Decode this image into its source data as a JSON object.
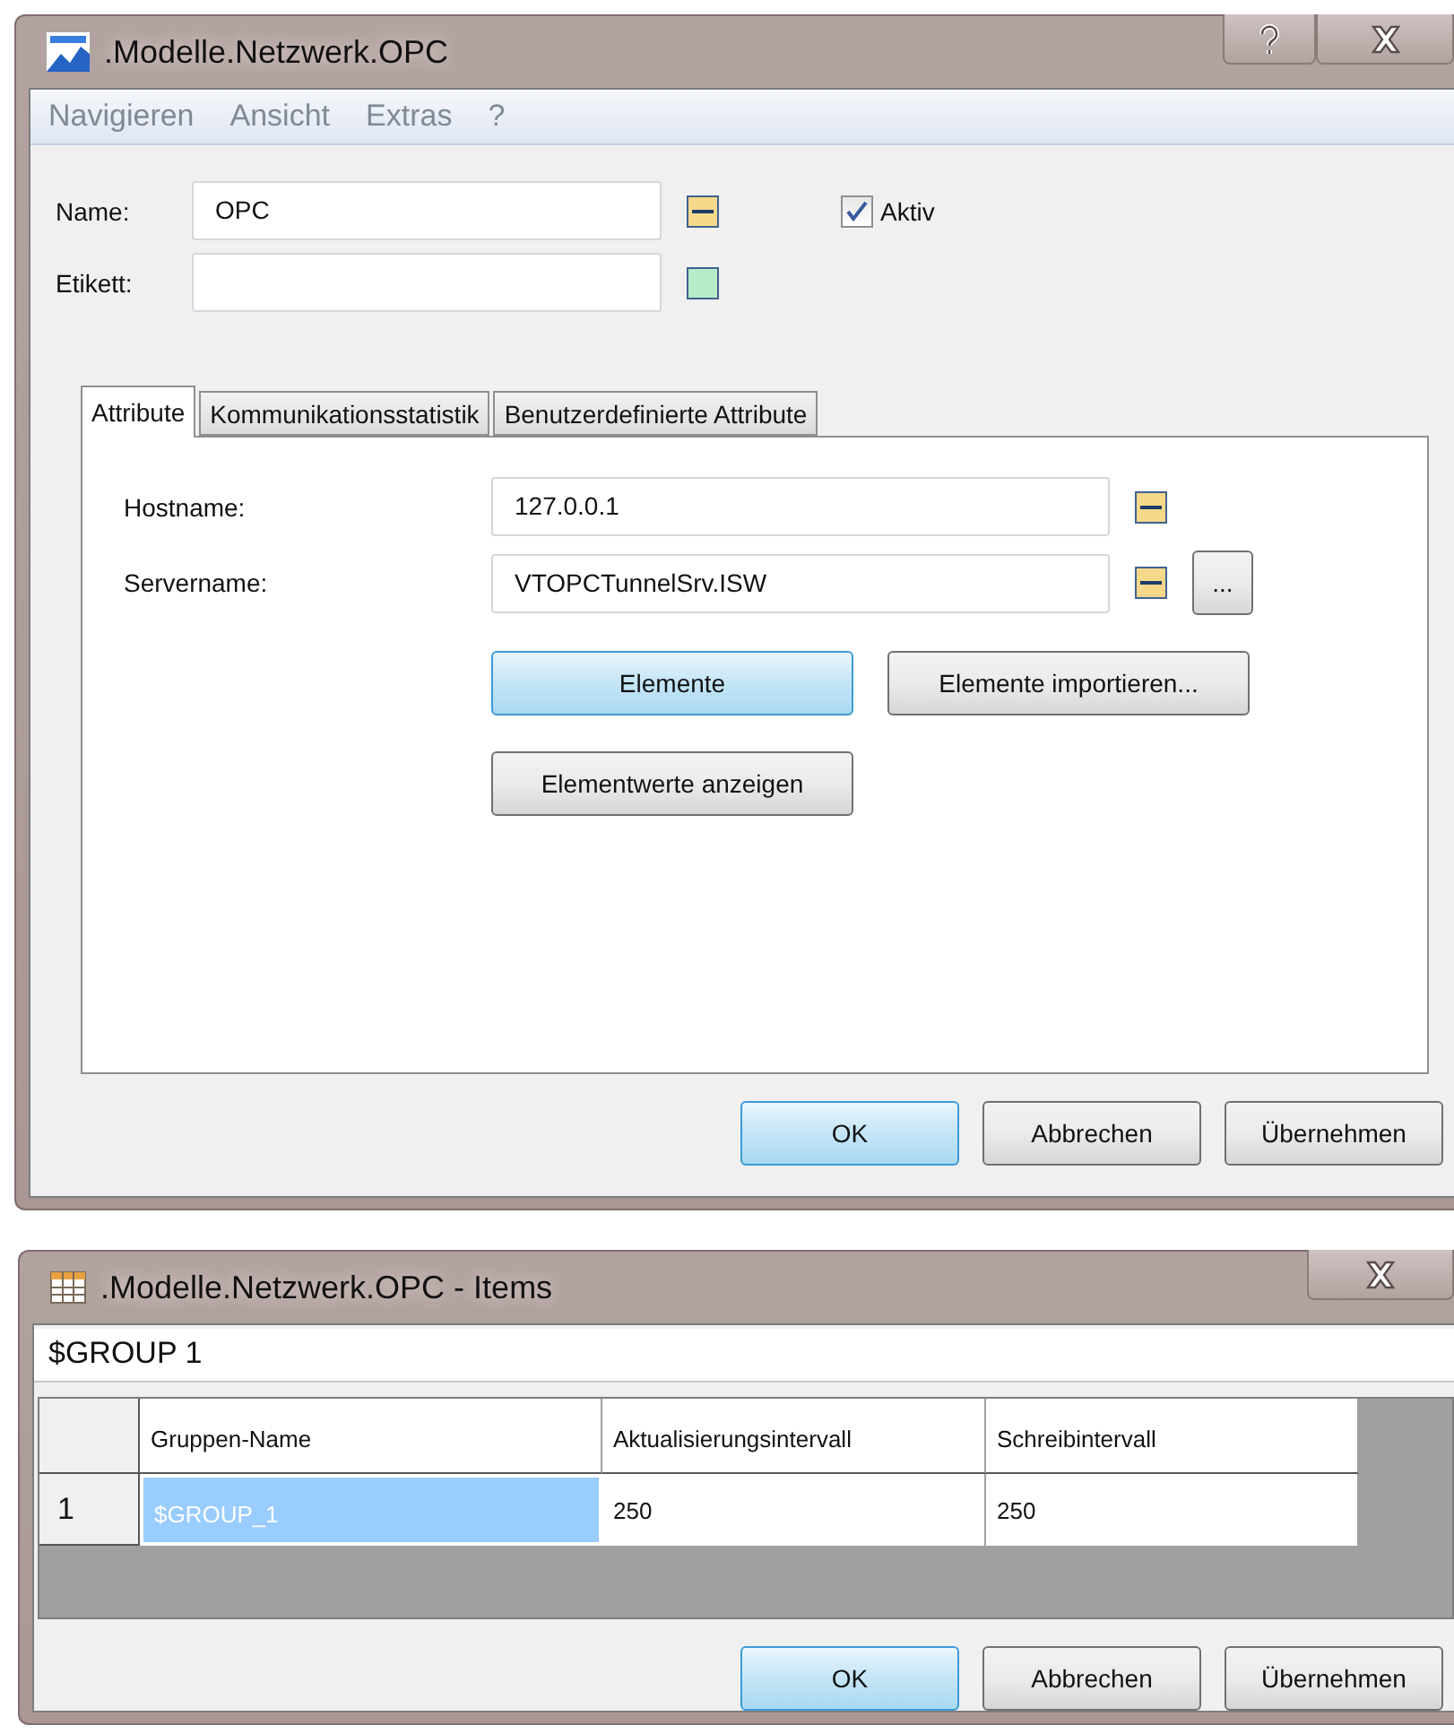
{
  "main_window": {
    "title": ".Modelle.Netzwerk.OPC",
    "menu": [
      "Navigieren",
      "Ansicht",
      "Extras",
      "?"
    ],
    "fields": [
      {
        "label": "Name:",
        "value": "OPC",
        "color": "#f6d88a"
      },
      {
        "label": "Etikett:",
        "color": "#b8ecc8"
      }
    ],
    "active_checkbox": {
      "label": "Aktiv",
      "checked": true
    },
    "tabs": [
      {
        "label": "Attribute",
        "selected": true
      },
      {
        "label": "Kommunikationsstatistik",
        "selected": false
      },
      {
        "label": "Benutzerdefinierte Attribute",
        "selected": false
      }
    ],
    "attributes": [
      {
        "label": "Hostname:",
        "value": "127.0.0.1",
        "color": "#f6d88a",
        "browse": false
      },
      {
        "label": "Servername:",
        "value": "VTOPCTunnelSrv.ISW",
        "color": "#f6d88a",
        "browse": true,
        "browse_label": "..."
      }
    ],
    "action_buttons": [
      {
        "label": "Elemente",
        "default": true
      },
      {
        "label": "Elemente importieren...",
        "default": false
      },
      {
        "label": "Elementwerte anzeigen",
        "default": false
      }
    ],
    "buttons": [
      {
        "label": "OK",
        "default": true
      },
      {
        "label": "Abbrechen",
        "default": false
      },
      {
        "label": "Übernehmen",
        "default": false
      }
    ]
  },
  "items_window": {
    "title": ".Modelle.Netzwerk.OPC - Items",
    "path": "$GROUP 1",
    "columns": [
      "Gruppen-Name",
      "Aktualisierungsintervall",
      "Schreibintervall"
    ],
    "rows": [
      {
        "number": "1",
        "cells": [
          {
            "text": "$GROUP_1",
            "selected": true
          },
          {
            "text": "250",
            "selected": false
          },
          {
            "text": "250",
            "selected": false
          }
        ]
      }
    ],
    "buttons": [
      {
        "label": "OK",
        "default": true
      },
      {
        "label": "Abbrechen",
        "default": false
      },
      {
        "label": "Übernehmen",
        "default": false
      }
    ]
  }
}
